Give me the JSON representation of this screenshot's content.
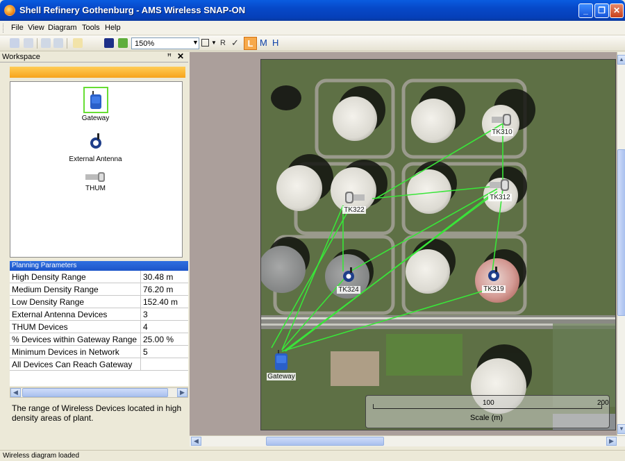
{
  "window": {
    "title": "Shell Refinery Gothenburg - AMS Wireless SNAP-ON"
  },
  "menu": [
    "File",
    "View",
    "Diagram",
    "Tools",
    "Help"
  ],
  "toolbar": {
    "zoom": "150%",
    "r_label": "R",
    "check_label": "✓",
    "l_label": "L",
    "m_label": "M",
    "h_label": "H"
  },
  "workspace": {
    "title": "Workspace",
    "pin": "ꟸ",
    "close": "✕",
    "items": [
      {
        "label": "Gateway",
        "icon": "gateway-icon"
      },
      {
        "label": "External Antenna",
        "icon": "antenna-icon"
      },
      {
        "label": "THUM",
        "icon": "thum-icon"
      }
    ]
  },
  "planning": {
    "title": "Planning Parameters",
    "rows": [
      {
        "key": "High Density Range",
        "value": "30.48 m"
      },
      {
        "key": "Medium Density Range",
        "value": "76.20 m"
      },
      {
        "key": "Low Density Range",
        "value": "152.40 m"
      },
      {
        "key": "External Antenna Devices",
        "value": "3"
      },
      {
        "key": "THUM Devices",
        "value": "4"
      },
      {
        "key": "% Devices within Gateway Range",
        "value": "25.00 %"
      },
      {
        "key": "Minimum Devices in Network",
        "value": "5"
      },
      {
        "key": "All Devices Can Reach Gateway",
        "value": ""
      }
    ],
    "description": "The range of Wireless Devices located in high density areas of plant."
  },
  "map": {
    "devices": [
      {
        "label": "TK310",
        "kind": "thum"
      },
      {
        "label": "TK322",
        "kind": "thum"
      },
      {
        "label": "TK312",
        "kind": "thum"
      },
      {
        "label": "TK324",
        "kind": "antenna"
      },
      {
        "label": "TK319",
        "kind": "antenna"
      },
      {
        "label": "Gateway",
        "kind": "gateway"
      }
    ],
    "scale": {
      "tick_mid": "100",
      "tick_end": "200",
      "label": "Scale (m)"
    },
    "link_color": "#39e639"
  },
  "status": "Wireless diagram loaded",
  "colors": {
    "accent": "#f7a41c",
    "title_blue": "#0648c8"
  }
}
